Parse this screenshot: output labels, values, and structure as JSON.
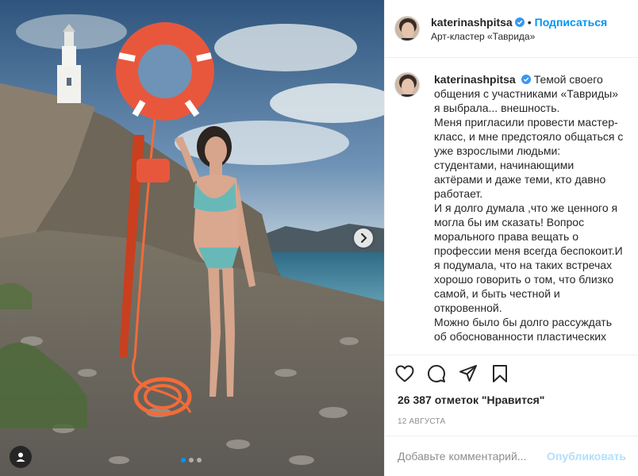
{
  "post": {
    "username": "katerinashpitsa",
    "follow_label": "Подписаться",
    "separator": "•",
    "location": "Арт-кластер «Таврида»",
    "caption": "Темой своего общения с участниками «Тавриды» я выбрала... внешность.\nМеня пригласили провести мастер-класс, и мне предстояло общаться с уже взрослыми людьми: студентами, начинающими актёрами и даже теми, кто давно работает.\nИ я долго думала ,что же ценного я могла бы им сказать! Вопрос морального права вещать о профессии меня всегда беспокоит.И я подумала, что на таких встречах хорошо говорить о том, что близко самой, и быть честной и откровенной.\nМожно было бы долго рассуждать об обоснованности пластических",
    "likes": "26 387 отметок \"Нравится\"",
    "date": "12 августа"
  },
  "actions": {
    "like_icon": "heart-icon",
    "comment_icon": "comment-icon",
    "share_icon": "share-icon",
    "save_icon": "bookmark-icon"
  },
  "comment_box": {
    "placeholder": "Добавьте комментарий...",
    "publish_label": "Опубликовать"
  },
  "carousel": {
    "current": 1,
    "total": 3
  },
  "colors": {
    "accent": "#0095f6",
    "publish_disabled": "#b2dffc",
    "secondary_text": "#8e8e8e",
    "buoy": "#e8573c"
  }
}
